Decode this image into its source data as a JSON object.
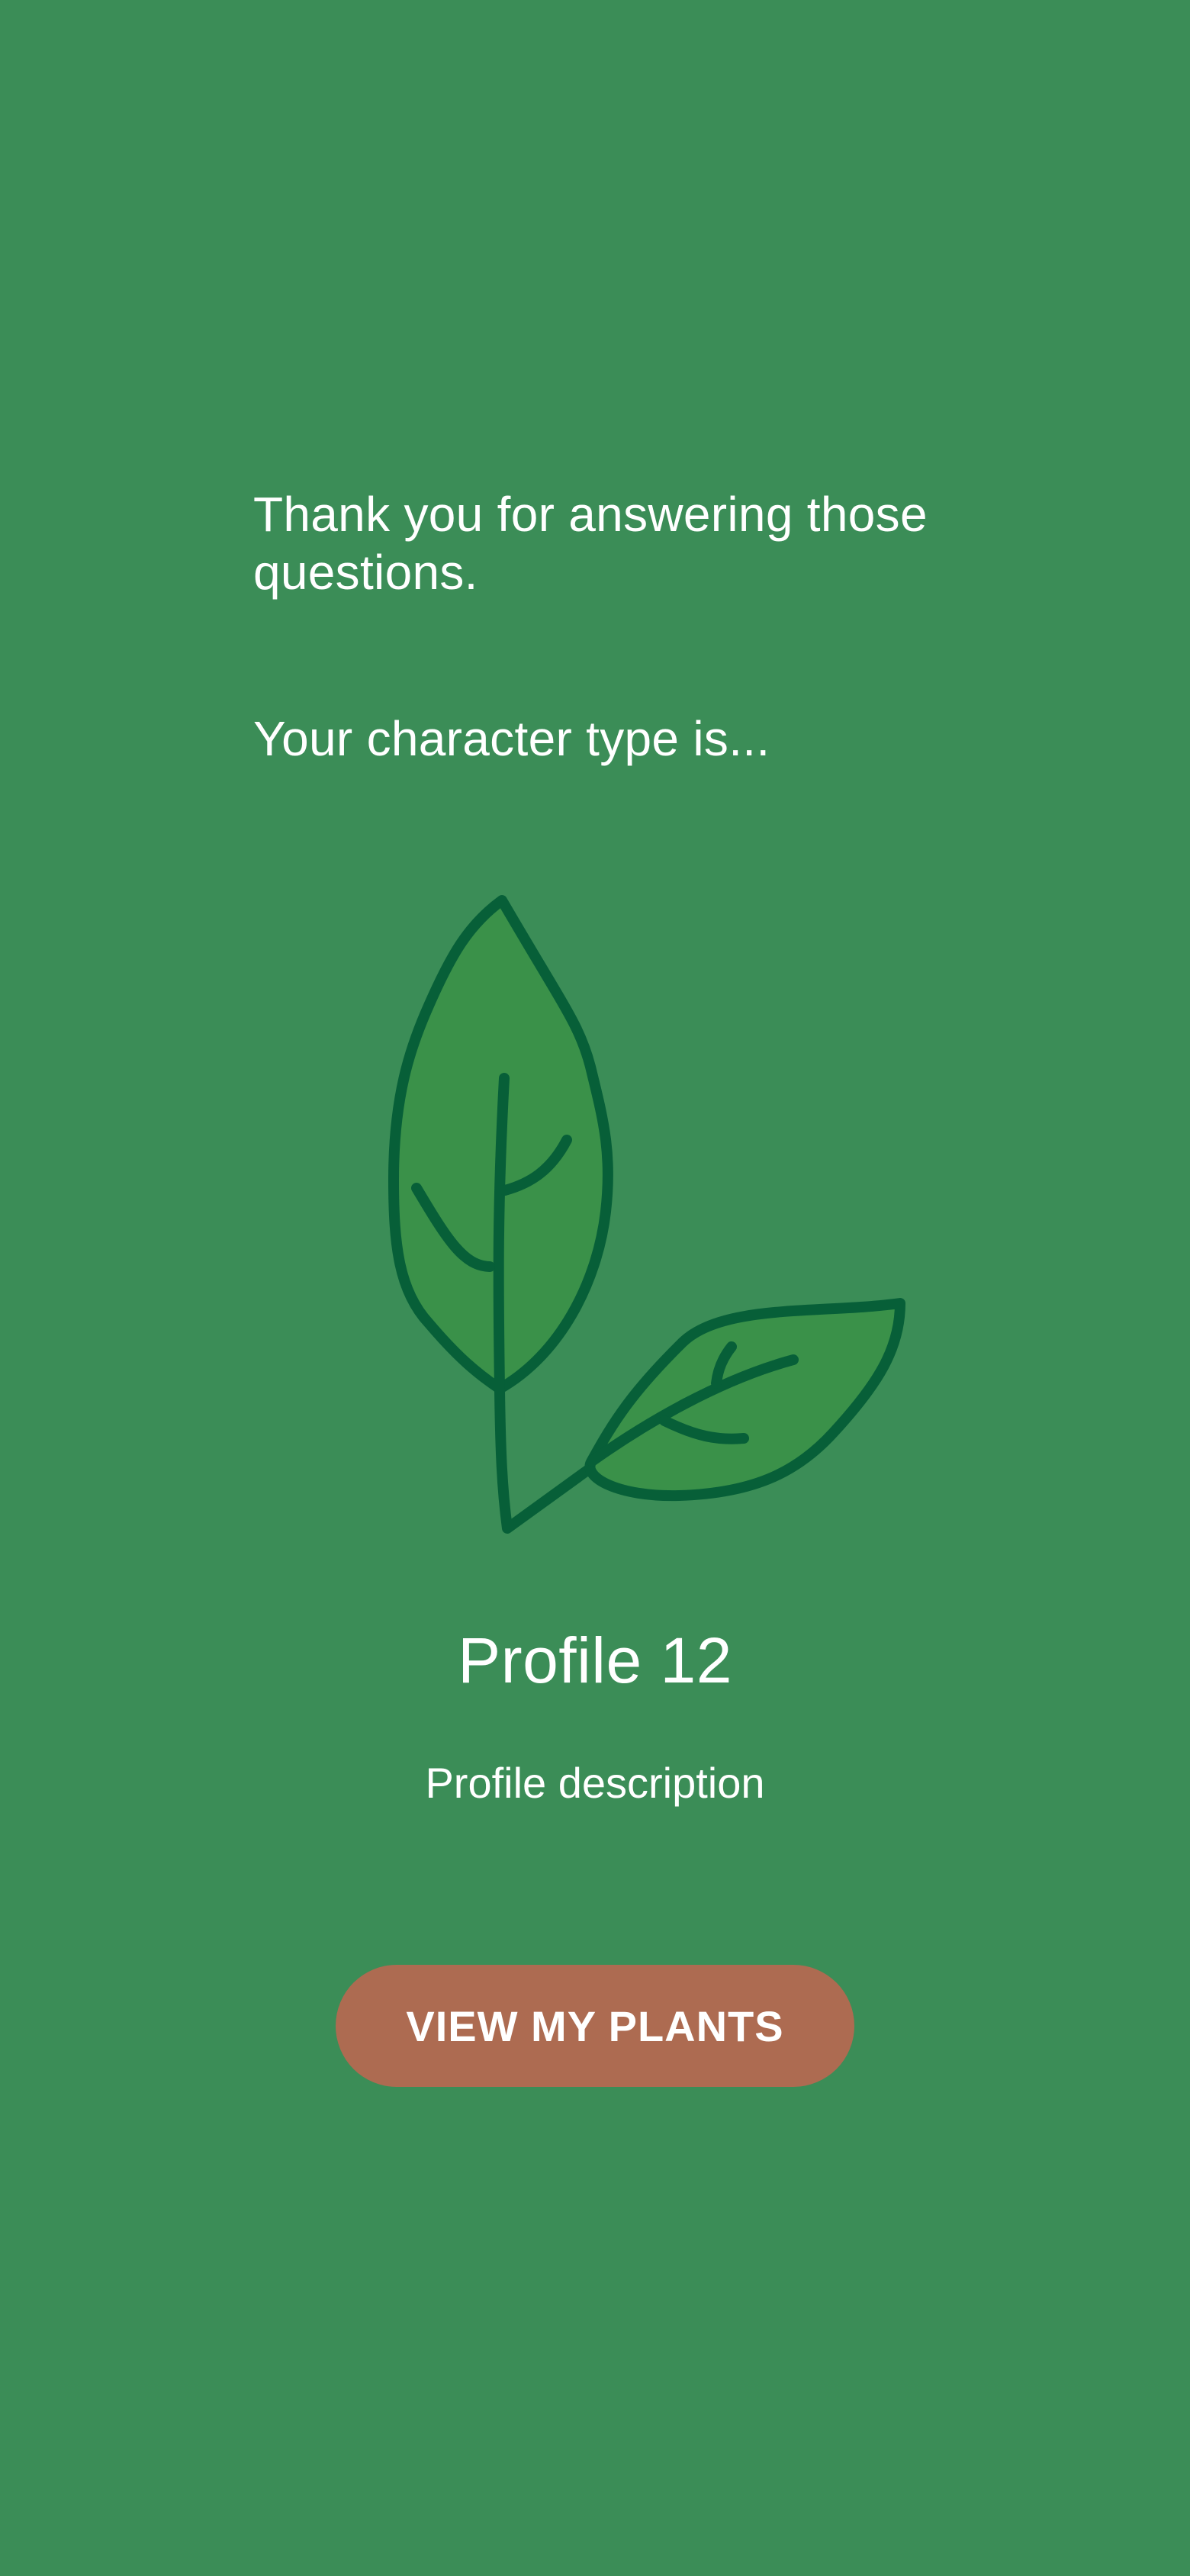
{
  "screen": {
    "background_color": "#3b8d57",
    "intro": {
      "thanks": "Thank you for answering those questions.",
      "type_prompt": "Your character type is..."
    },
    "illustration": {
      "icon": "leaf-sprout-icon",
      "leaf_fill_color": "#3a9149",
      "outline_color": "#075f38"
    },
    "profile": {
      "title": "Profile 12",
      "description": "Profile description"
    },
    "cta": {
      "label": "VIEW MY PLANTS",
      "background_color": "#ad6b51"
    }
  }
}
